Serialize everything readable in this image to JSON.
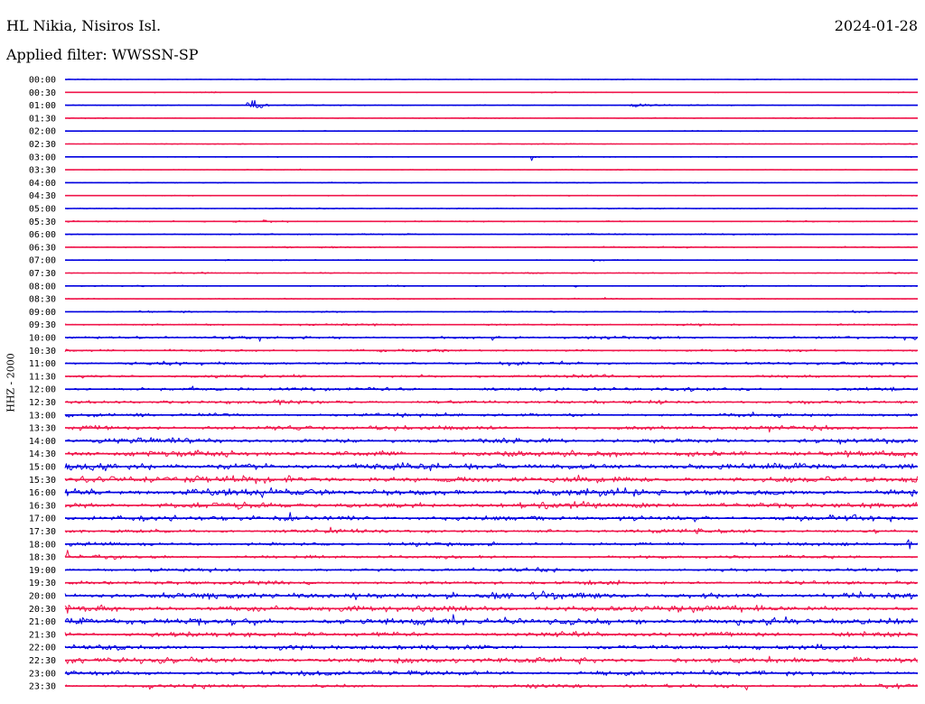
{
  "header": {
    "station": "HL Nikia, Nisiros Isl.",
    "date": "2024-01-28",
    "filter": "Applied filter: WWSSN-SP"
  },
  "chart_data": {
    "type": "line",
    "title": "HL Nikia, Nisiros Isl.",
    "ylabel": "HHZ - 2000",
    "colors": {
      "even": "#0000e0",
      "odd": "#f0144a"
    },
    "rows": [
      {
        "label": "00:00",
        "amp": 0.6
      },
      {
        "label": "00:30",
        "amp": 0.6
      },
      {
        "label": "01:00",
        "amp": 0.8,
        "events": [
          {
            "pos": 0.215,
            "amp": 17,
            "dur": 0.025
          },
          {
            "pos": 0.665,
            "amp": 5,
            "dur": 0.04
          }
        ]
      },
      {
        "label": "01:30",
        "amp": 0.7
      },
      {
        "label": "02:00",
        "amp": 0.7
      },
      {
        "label": "02:30",
        "amp": 0.6
      },
      {
        "label": "03:00",
        "amp": 0.7,
        "events": [
          {
            "pos": 0.548,
            "amp": 7,
            "dur": 0.012
          }
        ]
      },
      {
        "label": "03:30",
        "amp": 0.6
      },
      {
        "label": "04:00",
        "amp": 0.7
      },
      {
        "label": "04:30",
        "amp": 0.7
      },
      {
        "label": "05:00",
        "amp": 0.8
      },
      {
        "label": "05:30",
        "amp": 1.0,
        "events": [
          {
            "pos": 0.23,
            "amp": 3,
            "dur": 0.02
          }
        ]
      },
      {
        "label": "06:00",
        "amp": 1.0
      },
      {
        "label": "06:30",
        "amp": 1.1
      },
      {
        "label": "07:00",
        "amp": 0.9
      },
      {
        "label": "07:30",
        "amp": 0.9
      },
      {
        "label": "08:00",
        "amp": 1.0,
        "events": [
          {
            "pos": 0.598,
            "amp": 3,
            "dur": 0.006
          }
        ]
      },
      {
        "label": "08:30",
        "amp": 0.9
      },
      {
        "label": "09:00",
        "amp": 1.1
      },
      {
        "label": "09:30",
        "amp": 1.4
      },
      {
        "label": "10:00",
        "amp": 2.0,
        "events": [
          {
            "pos": 0.997,
            "amp": 9,
            "dur": 0.004
          }
        ]
      },
      {
        "label": "10:30",
        "amp": 1.8
      },
      {
        "label": "11:00",
        "amp": 2.2
      },
      {
        "label": "11:30",
        "amp": 2.2
      },
      {
        "label": "12:00",
        "amp": 2.5
      },
      {
        "label": "12:30",
        "amp": 2.6
      },
      {
        "label": "13:00",
        "amp": 2.7
      },
      {
        "label": "13:30",
        "amp": 3.3
      },
      {
        "label": "14:00",
        "amp": 3.6
      },
      {
        "label": "14:30",
        "amp": 4.2
      },
      {
        "label": "15:00",
        "amp": 4.8
      },
      {
        "label": "15:30",
        "amp": 5.0
      },
      {
        "label": "16:00",
        "amp": 5.2
      },
      {
        "label": "16:30",
        "amp": 4.4
      },
      {
        "label": "17:00",
        "amp": 3.8
      },
      {
        "label": "17:30",
        "amp": 2.8
      },
      {
        "label": "18:00",
        "amp": 2.6,
        "events": [
          {
            "pos": 0.99,
            "amp": 8,
            "dur": 0.006
          }
        ]
      },
      {
        "label": "18:30",
        "amp": 2.4,
        "events": [
          {
            "pos": 0.003,
            "amp": 10,
            "dur": 0.005
          }
        ]
      },
      {
        "label": "19:00",
        "amp": 2.4
      },
      {
        "label": "19:30",
        "amp": 2.8
      },
      {
        "label": "20:00",
        "amp": 4.6,
        "events": [
          {
            "pos": 0.45,
            "amp": 7,
            "dur": 0.03
          },
          {
            "pos": 0.99,
            "amp": 8,
            "dur": 0.008
          }
        ]
      },
      {
        "label": "20:30",
        "amp": 5.0
      },
      {
        "label": "21:00",
        "amp": 5.2
      },
      {
        "label": "21:30",
        "amp": 3.8
      },
      {
        "label": "22:00",
        "amp": 3.6
      },
      {
        "label": "22:30",
        "amp": 4.2
      },
      {
        "label": "23:00",
        "amp": 3.6
      },
      {
        "label": "23:30",
        "amp": 2.8,
        "events": [
          {
            "pos": 0.8,
            "amp": 6,
            "dur": 0.006
          }
        ]
      }
    ]
  }
}
